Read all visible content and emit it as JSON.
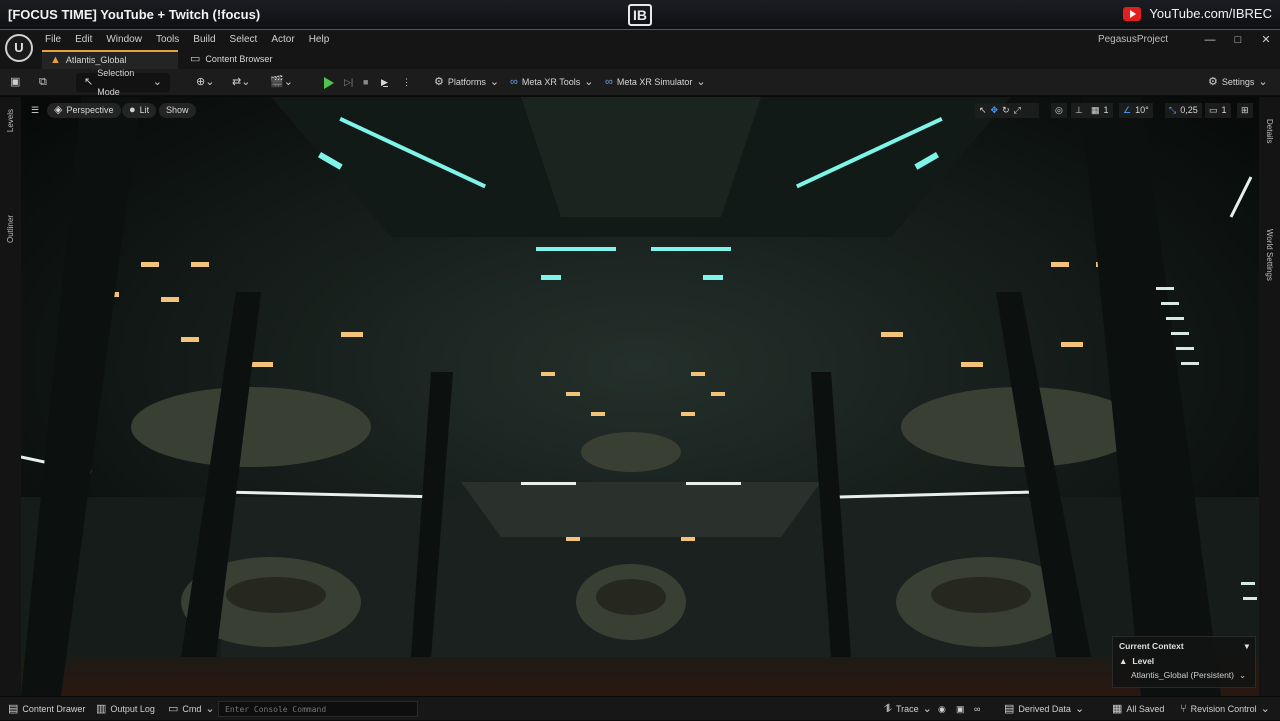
{
  "banner": {
    "title": "[FOCUS TIME] YouTube + Twitch (!focus)",
    "logo_text": "IB",
    "youtube_label": "YouTube.com/IBREC"
  },
  "menubar": {
    "items": [
      "File",
      "Edit",
      "Window",
      "Tools",
      "Build",
      "Select",
      "Actor",
      "Help"
    ],
    "project_name": "PegasusProject",
    "window_buttons": [
      "—",
      "□",
      "✕"
    ]
  },
  "tabs": {
    "level_tab": "Atlantis_Global",
    "content_browser": "Content Browser"
  },
  "toolbar": {
    "selection_mode": "Selection Mode",
    "platforms": "Platforms",
    "meta_xr_tools": "Meta XR Tools",
    "meta_xr_simulator": "Meta XR Simulator",
    "settings": "Settings"
  },
  "side": {
    "levels": "Levels",
    "outliner": "Outliner",
    "details": "Details",
    "world_settings": "World Settings"
  },
  "viewport": {
    "perspective": "Perspective",
    "lit": "Lit",
    "show": "Show",
    "grid_size": "1",
    "rotation_snap": "10°",
    "scale_snap": "0,25",
    "camera_speed": "1"
  },
  "context": {
    "header": "Current Context",
    "level_label": "Level",
    "level_value": "Atlantis_Global (Persistent)"
  },
  "statusbar": {
    "content_drawer": "Content Drawer",
    "output_log": "Output Log",
    "cmd": "Cmd",
    "console_placeholder": "Enter Console Command",
    "trace": "Trace",
    "derived_data": "Derived Data",
    "all_saved": "All Saved",
    "revision_control": "Revision Control"
  },
  "colors": {
    "accent_tab": "#e6a03c",
    "play_green": "#4fc34c",
    "youtube_red": "#e02020",
    "banner_line": "#2a5aa8"
  }
}
